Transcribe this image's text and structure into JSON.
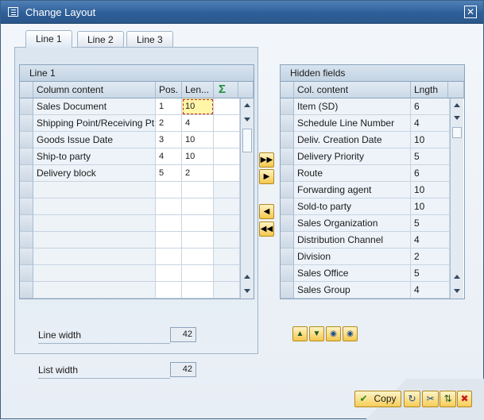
{
  "window": {
    "title": "Change Layout",
    "close_glyph": "✕"
  },
  "tabs": [
    {
      "label": "Line 1",
      "active": true
    },
    {
      "label": "Line 2",
      "active": false
    },
    {
      "label": "Line 3",
      "active": false
    }
  ],
  "line_table": {
    "title": "Line 1",
    "columns": [
      "Column content",
      "Pos.",
      "Len...",
      "Σ"
    ],
    "rows": [
      {
        "content": "Sales Document",
        "pos": "1",
        "len": "10"
      },
      {
        "content": "Shipping Point/Receiving Pt",
        "pos": "2",
        "len": "4"
      },
      {
        "content": "Goods Issue Date",
        "pos": "3",
        "len": "10"
      },
      {
        "content": "Ship-to party",
        "pos": "4",
        "len": "10"
      },
      {
        "content": "Delivery block",
        "pos": "5",
        "len": "2"
      }
    ],
    "empty_rows": 7
  },
  "hidden_table": {
    "title": "Hidden fields",
    "columns": [
      "Col. content",
      "Lngth"
    ],
    "rows": [
      {
        "content": "Item (SD)",
        "len": "6"
      },
      {
        "content": "Schedule Line Number",
        "len": "4"
      },
      {
        "content": "Deliv. Creation Date",
        "len": "10"
      },
      {
        "content": "Delivery Priority",
        "len": "5"
      },
      {
        "content": "Route",
        "len": "6"
      },
      {
        "content": "Forwarding agent",
        "len": "10"
      },
      {
        "content": "Sold-to party",
        "len": "10"
      },
      {
        "content": "Sales Organization",
        "len": "5"
      },
      {
        "content": "Distribution Channel",
        "len": "4"
      },
      {
        "content": "Division",
        "len": "2"
      },
      {
        "content": "Sales Office",
        "len": "5"
      },
      {
        "content": "Sales Group",
        "len": "4"
      }
    ]
  },
  "move_buttons": {
    "all_right": "▶▶",
    "right": "▶",
    "left": "◀",
    "all_left": "◀◀"
  },
  "line_width": {
    "label": "Line width",
    "value": "42"
  },
  "list_width": {
    "label": "List width",
    "value": "42"
  },
  "footer": {
    "copy_label": "Copy"
  },
  "colors": {
    "title_bar": "#2f5f98",
    "accent_button": "#f5c84d",
    "focus_cell": "#fff6a8"
  }
}
